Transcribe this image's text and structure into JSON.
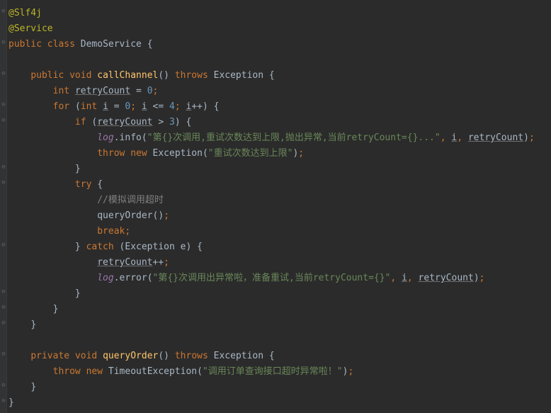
{
  "code": {
    "annotation1": "@Slf4j",
    "annotation2": "@Service",
    "kw_public": "public",
    "kw_class": "class",
    "className": "DemoService",
    "kw_void": "void",
    "method1": "callChannel",
    "kw_throws": "throws",
    "exceptionType": "Exception",
    "kw_int": "int",
    "var_retryCount": "retryCount",
    "num_0": "0",
    "kw_for": "for",
    "var_i": "i",
    "op_lte": "<=",
    "num_4": "4",
    "op_inc": "++",
    "kw_if": "if",
    "op_gt": ">",
    "num_3": "3",
    "field_log": "log",
    "method_info": "info",
    "str_info": "\"第{}次调用,重试次数达到上限,抛出异常,当前retryCount={}...\"",
    "kw_throw": "throw",
    "kw_new": "new",
    "str_throw": "\"重试次数达到上限\"",
    "kw_try": "try",
    "comment1": "//模拟调用超时",
    "method_queryOrder": "queryOrder",
    "kw_break": "break",
    "kw_catch": "catch",
    "var_e": "e",
    "method_error": "error",
    "str_error": "\"第{}次调用出异常啦，准备重试,当前retryCount={}\"",
    "kw_private": "private",
    "timeoutException": "TimeoutException",
    "str_timeout": "\"调用订单查询接口超时异常啦！\""
  }
}
